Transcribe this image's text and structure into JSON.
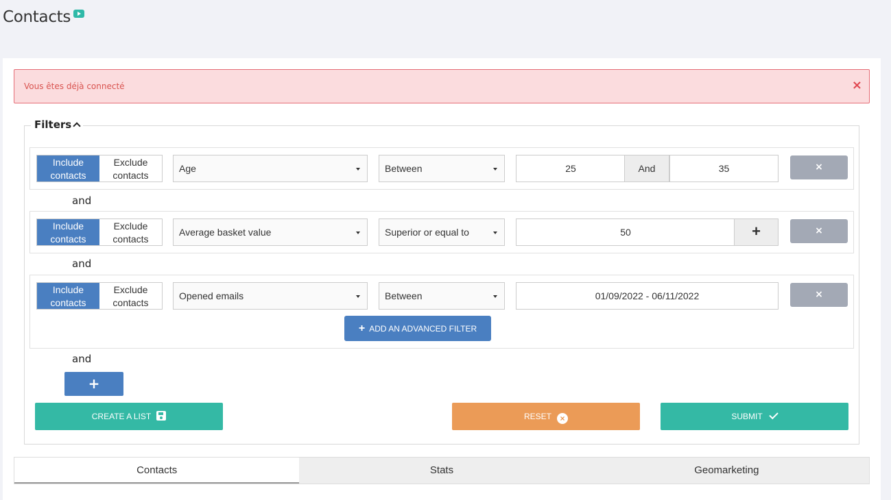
{
  "page": {
    "title": "Contacts",
    "video_icon": "video-play-icon"
  },
  "alert": {
    "text": "Vous êtes déjà connecté",
    "close": "×"
  },
  "filters": {
    "legend": "Filters",
    "include_label": "Include contacts",
    "exclude_label": "Exclude contacts",
    "connector": "and",
    "rows": [
      {
        "field": "Age",
        "operator": "Between",
        "value_from": "25",
        "value_sep": "And",
        "value_to": "35"
      },
      {
        "field": "Average basket value",
        "operator": "Superior or equal to",
        "value": "50",
        "addon": "+"
      },
      {
        "field": "Opened emails",
        "operator": "Between",
        "value": "01/09/2022 - 06/11/2022"
      }
    ],
    "delete_label": "×",
    "advanced_filter_label": "ADD AN ADVANCED FILTER",
    "advanced_filter_plus": "+",
    "add_filter_label": "+"
  },
  "actions": {
    "create_list": "CREATE A LIST",
    "reset": "RESET",
    "reset_icon": "×",
    "submit": "SUBMIT"
  },
  "tabs": [
    "Contacts",
    "Stats",
    "Geomarketing"
  ],
  "colors": {
    "primary": "#4a7fc1",
    "green": "#34b9a5",
    "orange": "#eb9b57",
    "alert_bg": "#fbdcde",
    "alert_text": "#d9534f"
  }
}
